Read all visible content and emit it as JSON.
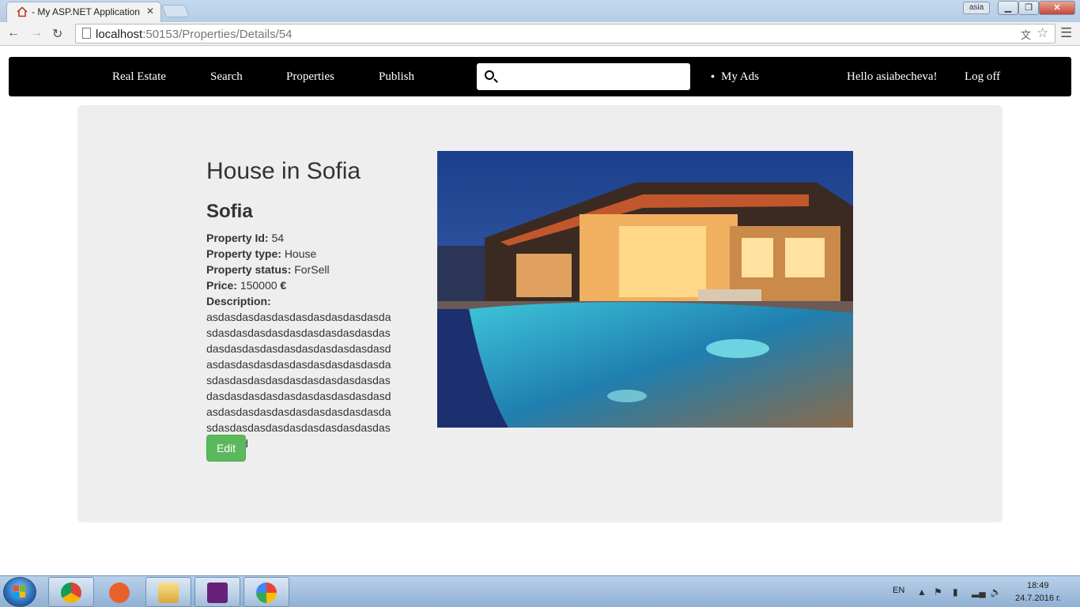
{
  "browser": {
    "tab_title": "- My ASP.NET Application",
    "tab_close": "✕",
    "profile_label": "asia",
    "url_host": "localhost",
    "url_rest": ":50153/Properties/Details/54"
  },
  "navbar": {
    "brand": "Real Estate",
    "links": [
      "Search",
      "Properties",
      "Publish"
    ],
    "search_placeholder": "",
    "my_ads": "My Ads",
    "greeting": "Hello asiabecheva!",
    "logoff": "Log off"
  },
  "property": {
    "title": "House in Sofia",
    "city": "Sofia",
    "id_label": "Property Id:",
    "id_value": "54",
    "type_label": "Property type:",
    "type_value": "House",
    "status_label": "Property status:",
    "status_value": "ForSell",
    "price_label": "Price:",
    "price_value": "150000",
    "price_currency": "€",
    "description_label": "Description:",
    "description_value": "asdasdasdasdasdasdasdasdasdasdasdasdasdasdasdasdasdasdasdasdasdasdasdasdasdasdasdasdasdasdasdasdasdasdasdasdasdasdasdasdasdasdasdasdasdasdasdasdasdasdasdasdasdasdasdasdasdasdasdasdasdasdasdasdasdasdasdasdasdasdasdasdasdasdasdasdasdasdasdasdasdasdasdasdasd",
    "edit_label": "Edit"
  },
  "taskbar": {
    "language": "EN",
    "time": "18:49",
    "date": "24.7.2016 г."
  },
  "colors": {
    "navbar_bg": "#000000",
    "jumbotron_bg": "#eeeeee",
    "edit_button": "#5cb85c"
  }
}
